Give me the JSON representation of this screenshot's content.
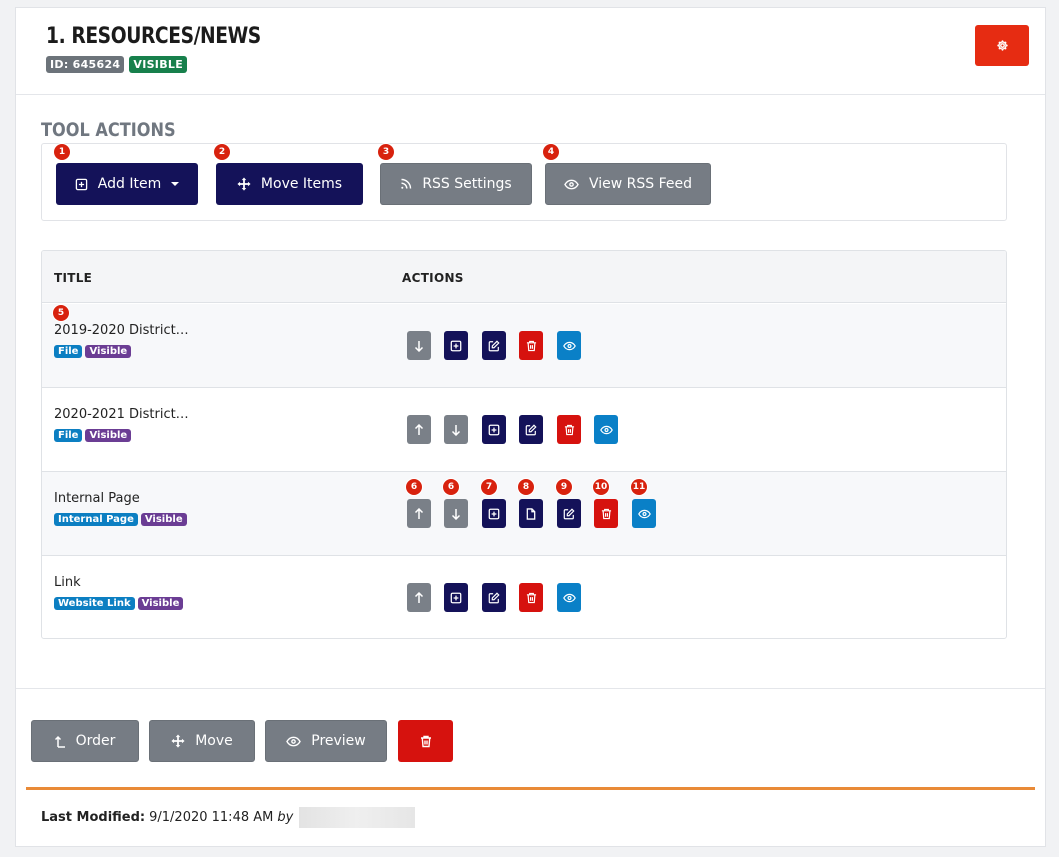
{
  "header": {
    "title": "1. RESOURCES/NEWS",
    "id_badge": "ID: 645624",
    "visibility_badge": "VISIBLE",
    "settings_icon": "gear-icon"
  },
  "tool_actions": {
    "title": "TOOL ACTIONS",
    "buttons": [
      {
        "label": "Add Item",
        "icon": "plus-square-icon",
        "marker": "1"
      },
      {
        "label": "Move Items",
        "icon": "move-icon",
        "marker": "2"
      },
      {
        "label": "RSS Settings",
        "icon": "rss-icon",
        "marker": "3"
      },
      {
        "label": "View RSS Feed",
        "icon": "eye-icon",
        "marker": "4"
      }
    ]
  },
  "table": {
    "headers": {
      "title": "TITLE",
      "actions": "ACTIONS"
    },
    "row_marker": "5",
    "rows": [
      {
        "title": "2019-2020 District…",
        "badges": [
          "File",
          "Visible"
        ]
      },
      {
        "title": "2020-2021 District…",
        "badges": [
          "File",
          "Visible"
        ]
      },
      {
        "title": "Internal Page",
        "badges": [
          "Internal Page",
          "Visible"
        ]
      },
      {
        "title": "Link",
        "badges": [
          "Website Link",
          "Visible"
        ]
      }
    ],
    "action_markers": [
      "6",
      "6",
      "7",
      "8",
      "9",
      "10",
      "11"
    ]
  },
  "footer": {
    "buttons": [
      {
        "label": "Order",
        "icon": "order-icon"
      },
      {
        "label": "Move",
        "icon": "move-icon"
      },
      {
        "label": "Preview",
        "icon": "eye-icon"
      },
      {
        "label": "",
        "icon": "trash-icon"
      }
    ],
    "last_modified_label": "Last Modified:",
    "last_modified_value": "9/1/2020 11:48 AM",
    "by_label": "by"
  },
  "colors": {
    "navy": "#141259",
    "gray": "#767c84",
    "red": "#d6120e",
    "blue": "#0a80c7",
    "accent_orange": "#e98a37",
    "badge_green": "#17804c",
    "badge_purple": "#6b3d94"
  }
}
